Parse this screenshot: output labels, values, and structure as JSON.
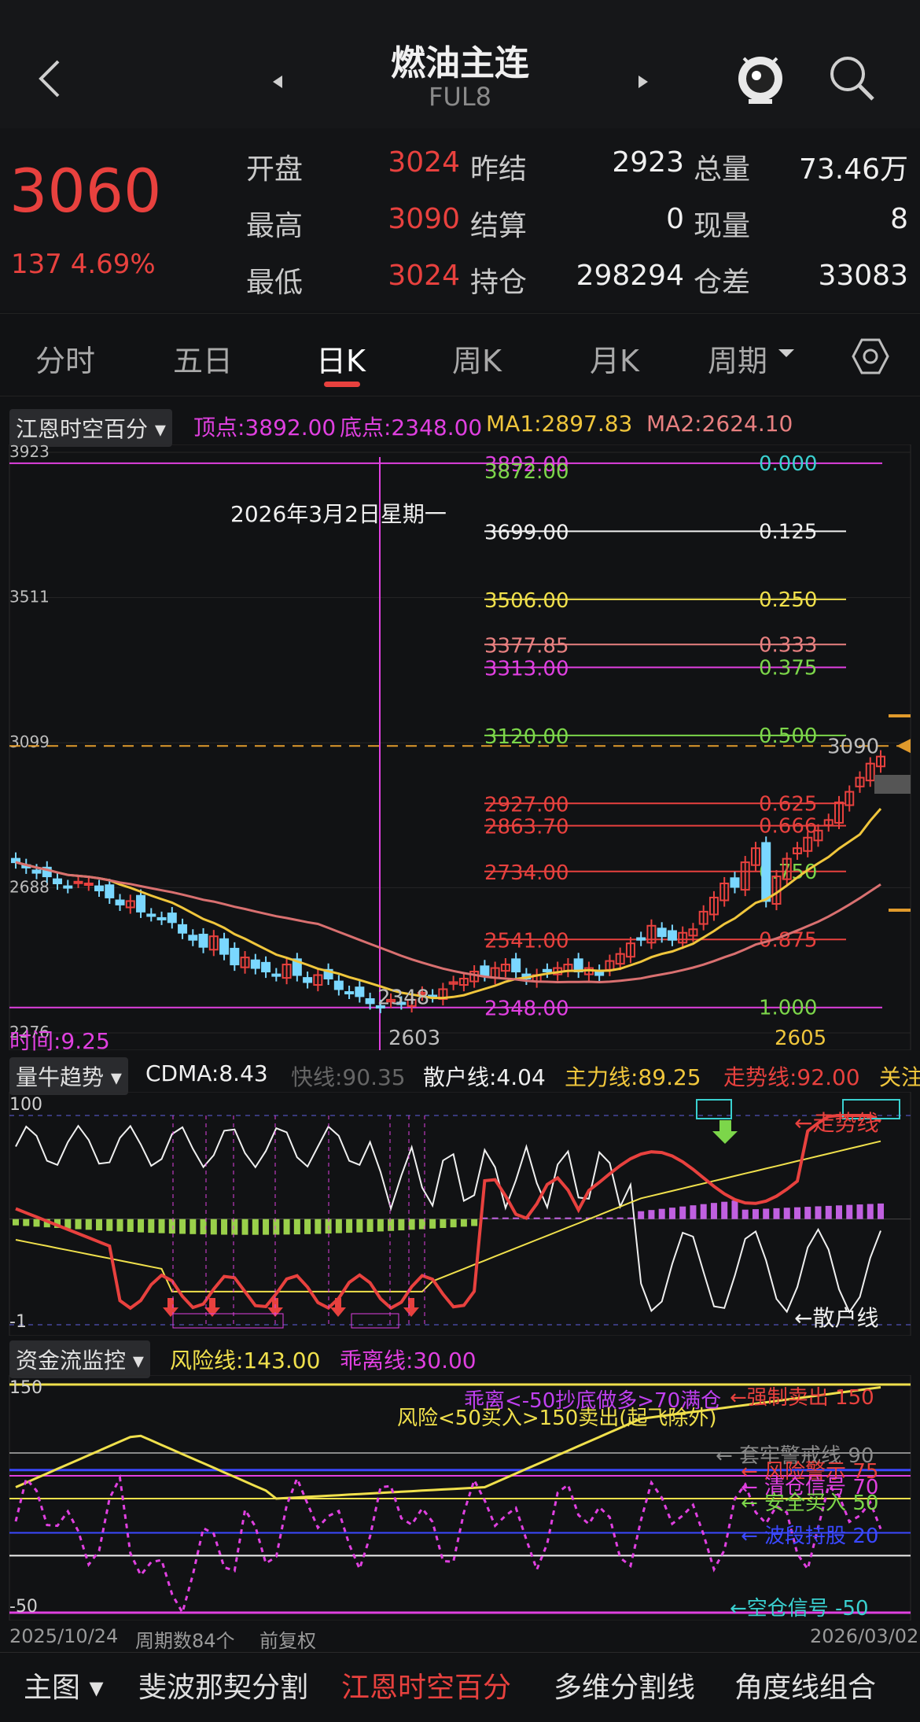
{
  "header": {
    "title": "燃油主连",
    "code": "FUL8"
  },
  "quote": {
    "price": "3060",
    "change": "137 4.69%",
    "rows": [
      {
        "l1": "开盘",
        "v1": "3024",
        "l2": "昨结",
        "v2": "2923",
        "l3": "总量",
        "v3": "73.46万"
      },
      {
        "l1": "最高",
        "v1": "3090",
        "l2": "结算",
        "v2": "0",
        "l3": "现量",
        "v3": "8"
      },
      {
        "l1": "最低",
        "v1": "3024",
        "l2": "持仓",
        "v2": "298294",
        "l3": "仓差",
        "v3": "33083"
      }
    ]
  },
  "tabs": [
    "分时",
    "五日",
    "日K",
    "周K",
    "月K",
    "周期"
  ],
  "main_panel": {
    "selector": "江恩时空百分",
    "top": "顶点:3892.00",
    "bottom": "底点:2348.00",
    "ma1": "MA1:2897.83",
    "ma2": "MA2:2624.10",
    "date_label": "2026年3月2日星期一",
    "y_ticks": [
      "3923",
      "3511",
      "3099",
      "2688",
      "2276"
    ],
    "last_price_tag": "3090",
    "low_label": "2348",
    "low_date_val": "2603",
    "right_low_val": "2605",
    "time_label": "时间:9.25",
    "levels": [
      {
        "price": "3892.00",
        "pct": "0.000"
      },
      {
        "price": "3872.00",
        "pct": ""
      },
      {
        "price": "3699.00",
        "pct": "0.125"
      },
      {
        "price": "3506.00",
        "pct": "0.250"
      },
      {
        "price": "3377.85",
        "pct": "0.333"
      },
      {
        "price": "3313.00",
        "pct": "0.375"
      },
      {
        "price": "3120.00",
        "pct": "0.500"
      },
      {
        "price": "2927.00",
        "pct": "0.625"
      },
      {
        "price": "2863.70",
        "pct": "0.666"
      },
      {
        "price": "2734.00",
        "pct": "0.750"
      },
      {
        "price": "2541.00",
        "pct": "0.875"
      },
      {
        "price": "2348.00",
        "pct": "1.000"
      }
    ]
  },
  "panel2": {
    "selector": "量牛趋势",
    "cdma": "CDMA:8.43",
    "kuai": "快线:90.35",
    "sanhu": "散户线:4.04",
    "zhuli": "主力线:89.25",
    "zoushi": "走势线:92.00",
    "guanzhu": "关注",
    "y_top": "100",
    "y_bot": "-1",
    "label_trend": "←走势线",
    "label_retail": "←散户线"
  },
  "panel3": {
    "selector": "资金流监控",
    "risk": "风险线:143.00",
    "dev": "乖离线:30.00",
    "y_top": "150",
    "y_bot": "-50",
    "note1": "乖离<-50抄底做多>70满仓",
    "note2": "风险<50买入>150卖出(起飞除外)",
    "r1": "←强制卖出 150",
    "r2": "← 套牢警戒线 90",
    "r3": "← 风险警示 75",
    "r4": "← 清仓信号 70",
    "r5": "← 安全买入 50",
    "r6": "← 波段持股 20",
    "r7": "←空仓信号 -50"
  },
  "footer": {
    "start": "2025/10/24",
    "count": "周期数84个",
    "adj": "前复权",
    "end": "2026/03/02"
  },
  "bottom_tabs": [
    "主图",
    "斐波那契分割",
    "江恩时空百分",
    "多维分割线",
    "角度线组合"
  ],
  "chart_data": {
    "type": "candlestick",
    "title": "燃油主连",
    "x_start": "2025/10/24",
    "x_end": "2026/03/02",
    "periods": 84,
    "ylim": [
      2276,
      3923
    ],
    "gann_levels": [
      3892,
      3699,
      3506,
      3377.85,
      3313,
      3120,
      2927,
      2863.7,
      2734,
      2541,
      2348
    ],
    "series": [
      {
        "name": "MA1",
        "last": 2897.83
      },
      {
        "name": "MA2",
        "last": 2624.1
      }
    ],
    "closes": [
      2760,
      2745,
      2730,
      2720,
      2700,
      2690,
      2705,
      2700,
      2680,
      2660,
      2640,
      2650,
      2620,
      2610,
      2600,
      2590,
      2560,
      2540,
      2520,
      2550,
      2500,
      2470,
      2490,
      2460,
      2450,
      2440,
      2470,
      2440,
      2420,
      2440,
      2430,
      2400,
      2390,
      2380,
      2360,
      2350,
      2370,
      2360,
      2370,
      2390,
      2380,
      2400,
      2420,
      2430,
      2450,
      2440,
      2460,
      2470,
      2450,
      2430,
      2440,
      2450,
      2460,
      2470,
      2450,
      2460,
      2440,
      2480,
      2500,
      2530,
      2540,
      2580,
      2550,
      2540,
      2560,
      2570,
      2620,
      2660,
      2700,
      2690,
      2760,
      2800,
      2650,
      2720,
      2770,
      2800,
      2830,
      2850,
      2880,
      2930,
      2960,
      3000,
      3040,
      3060
    ]
  }
}
